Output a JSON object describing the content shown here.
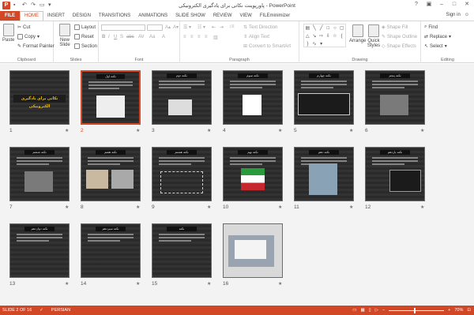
{
  "window": {
    "title": "پاورپوینت نکاتی برای یادگیری الکترونیکی - PowerPoint",
    "signin": "Sign in",
    "app_letter": "P"
  },
  "tabs": [
    "FILE",
    "HOME",
    "INSERT",
    "DESIGN",
    "TRANSITIONS",
    "ANIMATIONS",
    "SLIDE SHOW",
    "REVIEW",
    "VIEW",
    "FILEminimizer"
  ],
  "active_tab": "HOME",
  "ribbon": {
    "clipboard": {
      "paste": "Paste",
      "cut": "Cut",
      "copy": "Copy",
      "format_painter": "Format Painter",
      "label": "Clipboard"
    },
    "slides": {
      "new_slide": "New Slide",
      "layout": "Layout",
      "reset": "Reset",
      "section": "Section",
      "label": "Slides"
    },
    "font": {
      "label": "Font",
      "buttons": [
        "B",
        "I",
        "U",
        "S",
        "abc",
        "AV",
        "Aa",
        "A"
      ]
    },
    "paragraph": {
      "text_direction": "Text Direction",
      "align_text": "Align Text",
      "convert_smartart": "Convert to SmartArt",
      "label": "Paragraph"
    },
    "drawing": {
      "arrange": "Arrange",
      "quick_styles": "Quick Styles",
      "shape_fill": "Shape Fill",
      "shape_outline": "Shape Outline",
      "shape_effects": "Shape Effects",
      "label": "Drawing"
    },
    "editing": {
      "find": "Find",
      "replace": "Replace",
      "select": "Select",
      "label": "Editing"
    }
  },
  "slides": [
    {
      "num": "1",
      "title": "نکاتی برای یادگیری الکترونیکی",
      "kind": "title"
    },
    {
      "num": "2",
      "title": "نکته اول",
      "kind": "chart",
      "selected": true
    },
    {
      "num": "3",
      "title": "نکته دوم",
      "kind": "monitor"
    },
    {
      "num": "4",
      "title": "نکته سوم",
      "kind": "badge"
    },
    {
      "num": "5",
      "title": "نکته چهارم",
      "kind": "textbox"
    },
    {
      "num": "6",
      "title": "نکته پنجم",
      "kind": "photo"
    },
    {
      "num": "7",
      "title": "نکته ششم",
      "kind": "photo"
    },
    {
      "num": "8",
      "title": "نکته هفتم",
      "kind": "photos"
    },
    {
      "num": "9",
      "title": "نکته هشتم",
      "kind": "diagram"
    },
    {
      "num": "10",
      "title": "نکته نهم",
      "kind": "flag"
    },
    {
      "num": "11",
      "title": "نکته دهم",
      "kind": "buildings"
    },
    {
      "num": "12",
      "title": "نکته یازدهم",
      "kind": "list"
    },
    {
      "num": "13",
      "title": "نکته دوازدهم",
      "kind": "text"
    },
    {
      "num": "14",
      "title": "نکته سیزدهم",
      "kind": "text"
    },
    {
      "num": "15",
      "title": "نکته",
      "kind": "text"
    },
    {
      "num": "16",
      "title": "",
      "kind": "laptop"
    }
  ],
  "status": {
    "slide": "SLIDE 2 OF 16",
    "language": "PERSIAN",
    "zoom": "70%",
    "zoom_fraction": 0.46
  }
}
